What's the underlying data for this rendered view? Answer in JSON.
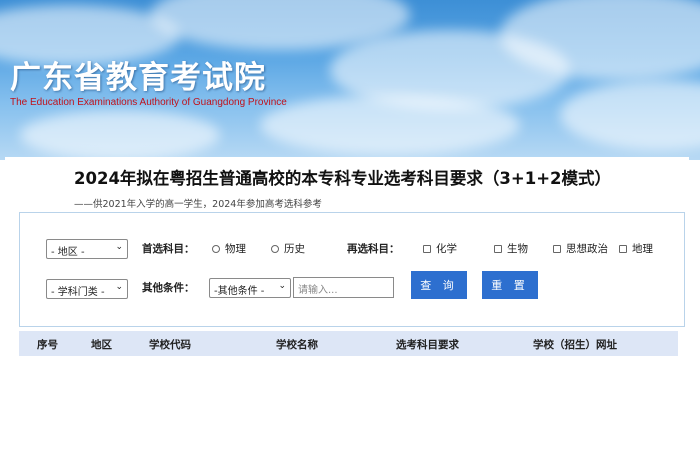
{
  "banner": {
    "title_cn": "广东省教育考试院",
    "title_en": "The Education Examinations Authority of Guangdong Province"
  },
  "page": {
    "title": "2024年拟在粤招生普通高校的本专科专业选考科目要求（3+1+2模式）",
    "subtitle": "——供2021年入学的高一学生，2024年参加高考选科参考"
  },
  "filters": {
    "region_select": "- 地区 -",
    "category_select": "- 学科门类 -",
    "first_subject_label": "首选科目：",
    "first_subjects": [
      "物理",
      "历史"
    ],
    "second_subject_label": "再选科目：",
    "second_subjects": [
      "化学",
      "生物",
      "思想政治",
      "地理"
    ],
    "other_label": "其他条件：",
    "other_select": "-其他条件 -",
    "input_placeholder": "请输入...",
    "query_button": "查 询",
    "reset_button": "重 置",
    "caret": "⌄"
  },
  "table": {
    "headers": [
      "序号",
      "地区",
      "学校代码",
      "学校名称",
      "选考科目要求",
      "学校（招生）网址"
    ]
  },
  "colors": {
    "accent": "#2d6fcf",
    "header_bg": "#dde6f6",
    "logo_en": "#c0121b"
  }
}
